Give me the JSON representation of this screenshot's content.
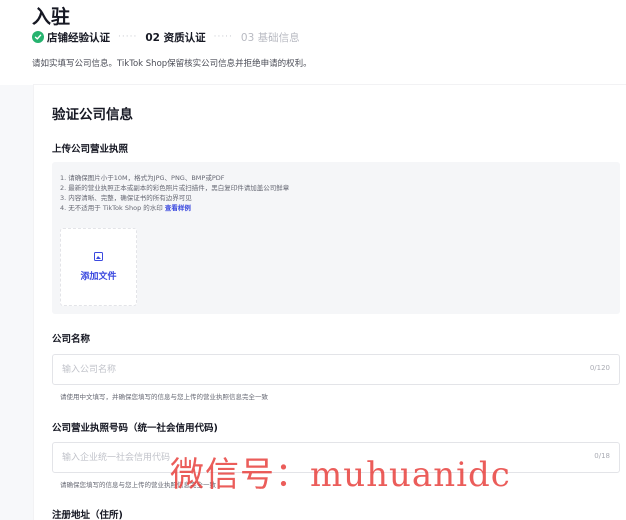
{
  "page": {
    "title": "入驻"
  },
  "steps": [
    {
      "label": "店铺经验认证",
      "state": "done"
    },
    {
      "label": "02 资质认证",
      "state": "active"
    },
    {
      "label": "03 基础信息",
      "state": "pending"
    }
  ],
  "step_separator": "·····",
  "notice": "请如实填写公司信息。TikTok Shop保留核实公司信息并拒绝申请的权利。",
  "section": {
    "title": "验证公司信息"
  },
  "license_upload": {
    "label": "上传公司营业执照",
    "hints": [
      "1. 请确保图片小于10M，格式为JPG、PNG、BMP或PDF",
      "2. 最新的营业执照正本或副本的彩色照片或扫描件，黑白复印件请加盖公司鲜章",
      "3. 内容清晰、完整，确保证书的所有边界可见",
      "4. 无不适用于 TikTok Shop 的水印"
    ],
    "sample_link": "查看样例",
    "add_file_label": "添加文件"
  },
  "company_name": {
    "label": "公司名称",
    "placeholder": "输入公司名称",
    "counter": "0/120",
    "helper": "请使用中文填写，并确保您填写的信息与您上传的营业执照信息完全一致"
  },
  "license_number": {
    "label": "公司营业执照号码（统一社会信用代码)",
    "placeholder": "输入企业统一社会信用代码",
    "counter": "0/18",
    "helper": "请确保您填写的信息与您上传的营业执照信息完全一致"
  },
  "address": {
    "label": "注册地址（住所)"
  },
  "watermark": "微信号：muhuanidc",
  "colors": {
    "accent": "#3b49df",
    "success": "#26b36f",
    "watermark": "#e8413e"
  }
}
